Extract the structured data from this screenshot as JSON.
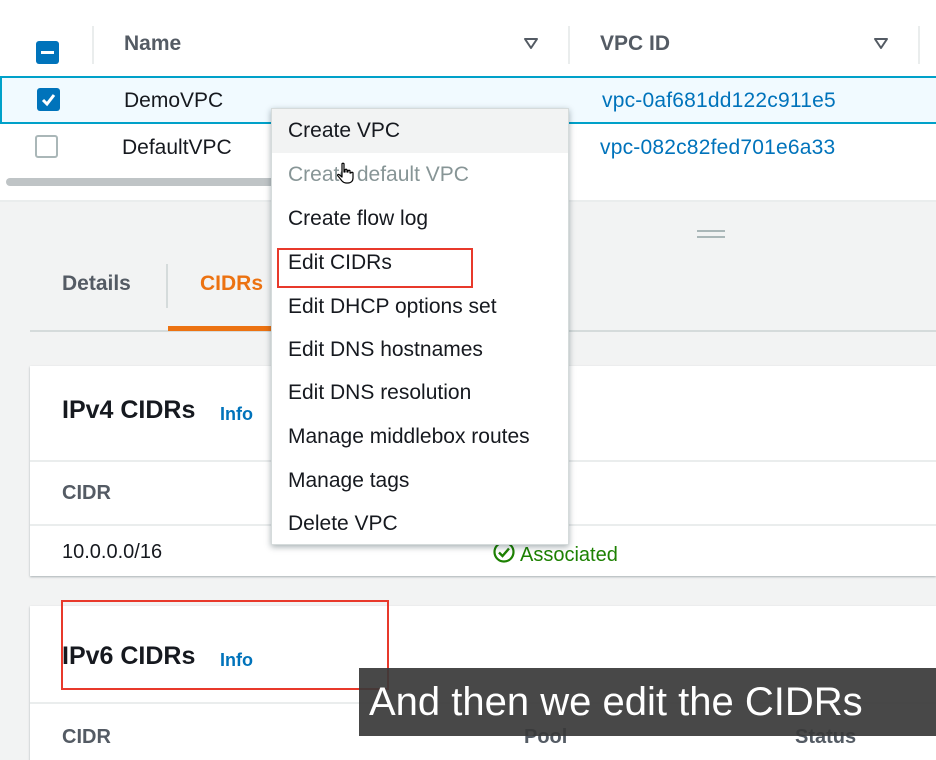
{
  "table": {
    "columns": [
      {
        "label": "Name"
      },
      {
        "label": "VPC ID"
      }
    ],
    "rows": [
      {
        "name": "DemoVPC",
        "vpc_id": "vpc-0af681dd122c911e5",
        "selected": true
      },
      {
        "name": "DefaultVPC",
        "vpc_id": "vpc-082c82fed701e6a33",
        "selected": false
      }
    ]
  },
  "context_menu": {
    "items": [
      {
        "label": "Create VPC",
        "state": "hover"
      },
      {
        "label": "Create default VPC",
        "state": "disabled"
      },
      {
        "label": "Create flow log",
        "state": "normal"
      },
      {
        "label": "Edit CIDRs",
        "state": "highlighted"
      },
      {
        "label": "Edit DHCP options set",
        "state": "normal"
      },
      {
        "label": "Edit DNS hostnames",
        "state": "normal"
      },
      {
        "label": "Edit DNS resolution",
        "state": "normal"
      },
      {
        "label": "Manage middlebox routes",
        "state": "normal"
      },
      {
        "label": "Manage tags",
        "state": "normal"
      },
      {
        "label": "Delete VPC",
        "state": "normal"
      }
    ]
  },
  "details_panel": {
    "tabs": [
      {
        "label": "Details",
        "active": false
      },
      {
        "label": "CIDRs",
        "active": true
      }
    ],
    "ipv4": {
      "title": "IPv4 CIDRs",
      "info": "Info",
      "column_cidr": "CIDR",
      "rows": [
        {
          "cidr": "10.0.0.0/16",
          "status": "Associated"
        }
      ]
    },
    "ipv6": {
      "title": "IPv6 CIDRs",
      "info": "Info",
      "columns": [
        "CIDR",
        "Pool",
        "Status"
      ]
    }
  },
  "caption": "And then we edit the CIDRs",
  "colors": {
    "accent_blue": "#0073bb",
    "tab_orange": "#ec7211",
    "status_green": "#1d8102",
    "highlight_red": "#e8392b"
  }
}
